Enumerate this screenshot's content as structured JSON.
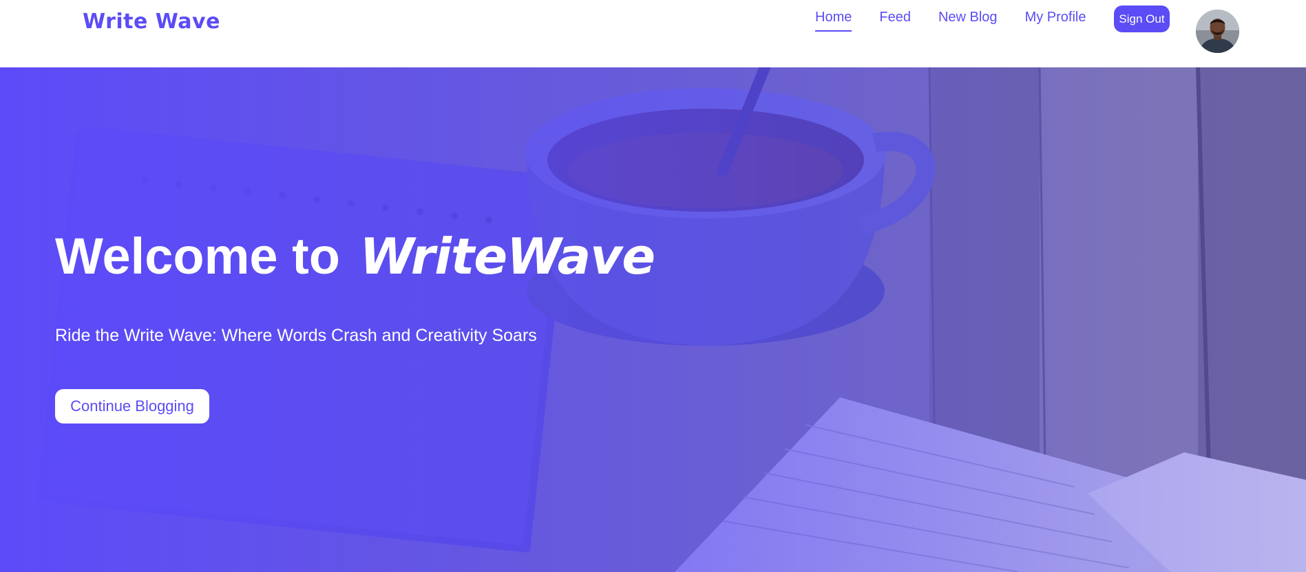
{
  "header": {
    "brand": "Write Wave",
    "nav": [
      {
        "label": "Home",
        "active": true
      },
      {
        "label": "Feed",
        "active": false
      },
      {
        "label": "New Blog",
        "active": false
      },
      {
        "label": "My Profile",
        "active": false
      }
    ],
    "sign_out_label": "Sign Out",
    "avatar_icon": "user-avatar-photo"
  },
  "hero": {
    "title_prefix": "Welcome to",
    "title_brand": "WriteWave",
    "subtitle": "Ride the Write Wave: Where Words Crash and Creativity Soars",
    "cta_label": "Continue Blogging",
    "background_image": "coffee-cup-notebook-on-wooden-table"
  },
  "colors": {
    "accent": "#5b4cf5",
    "white": "#ffffff",
    "overlay": "#5c4afa"
  }
}
